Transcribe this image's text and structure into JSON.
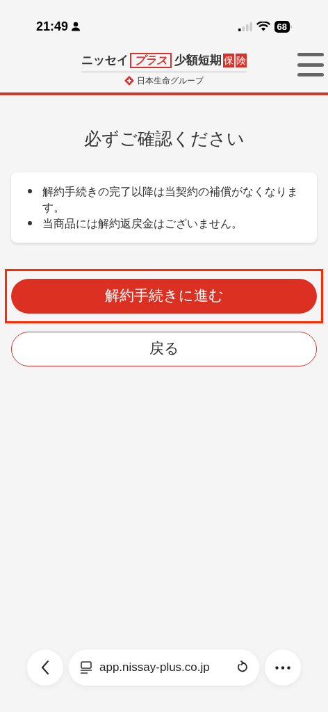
{
  "status_bar": {
    "time": "21:49",
    "battery": "68"
  },
  "header": {
    "logo": {
      "part_1": "ニッセイ",
      "part_2": "プラス",
      "part_3": "少額短期",
      "part_4": "保",
      "part_5": "険",
      "group": "日本生命グループ"
    }
  },
  "title": "必ずご確認ください",
  "notices": [
    "解約手続きの完了以降は当契約の補償がなくなります。",
    "当商品には解約返戻金はございません。"
  ],
  "buttons": [
    {
      "label": "解約手続きに進む",
      "kind": "primary",
      "highlighted": true
    },
    {
      "label": "戻る",
      "kind": "secondary",
      "highlighted": false
    }
  ],
  "browser_bar": {
    "url": "app.nissay-plus.co.jp"
  }
}
